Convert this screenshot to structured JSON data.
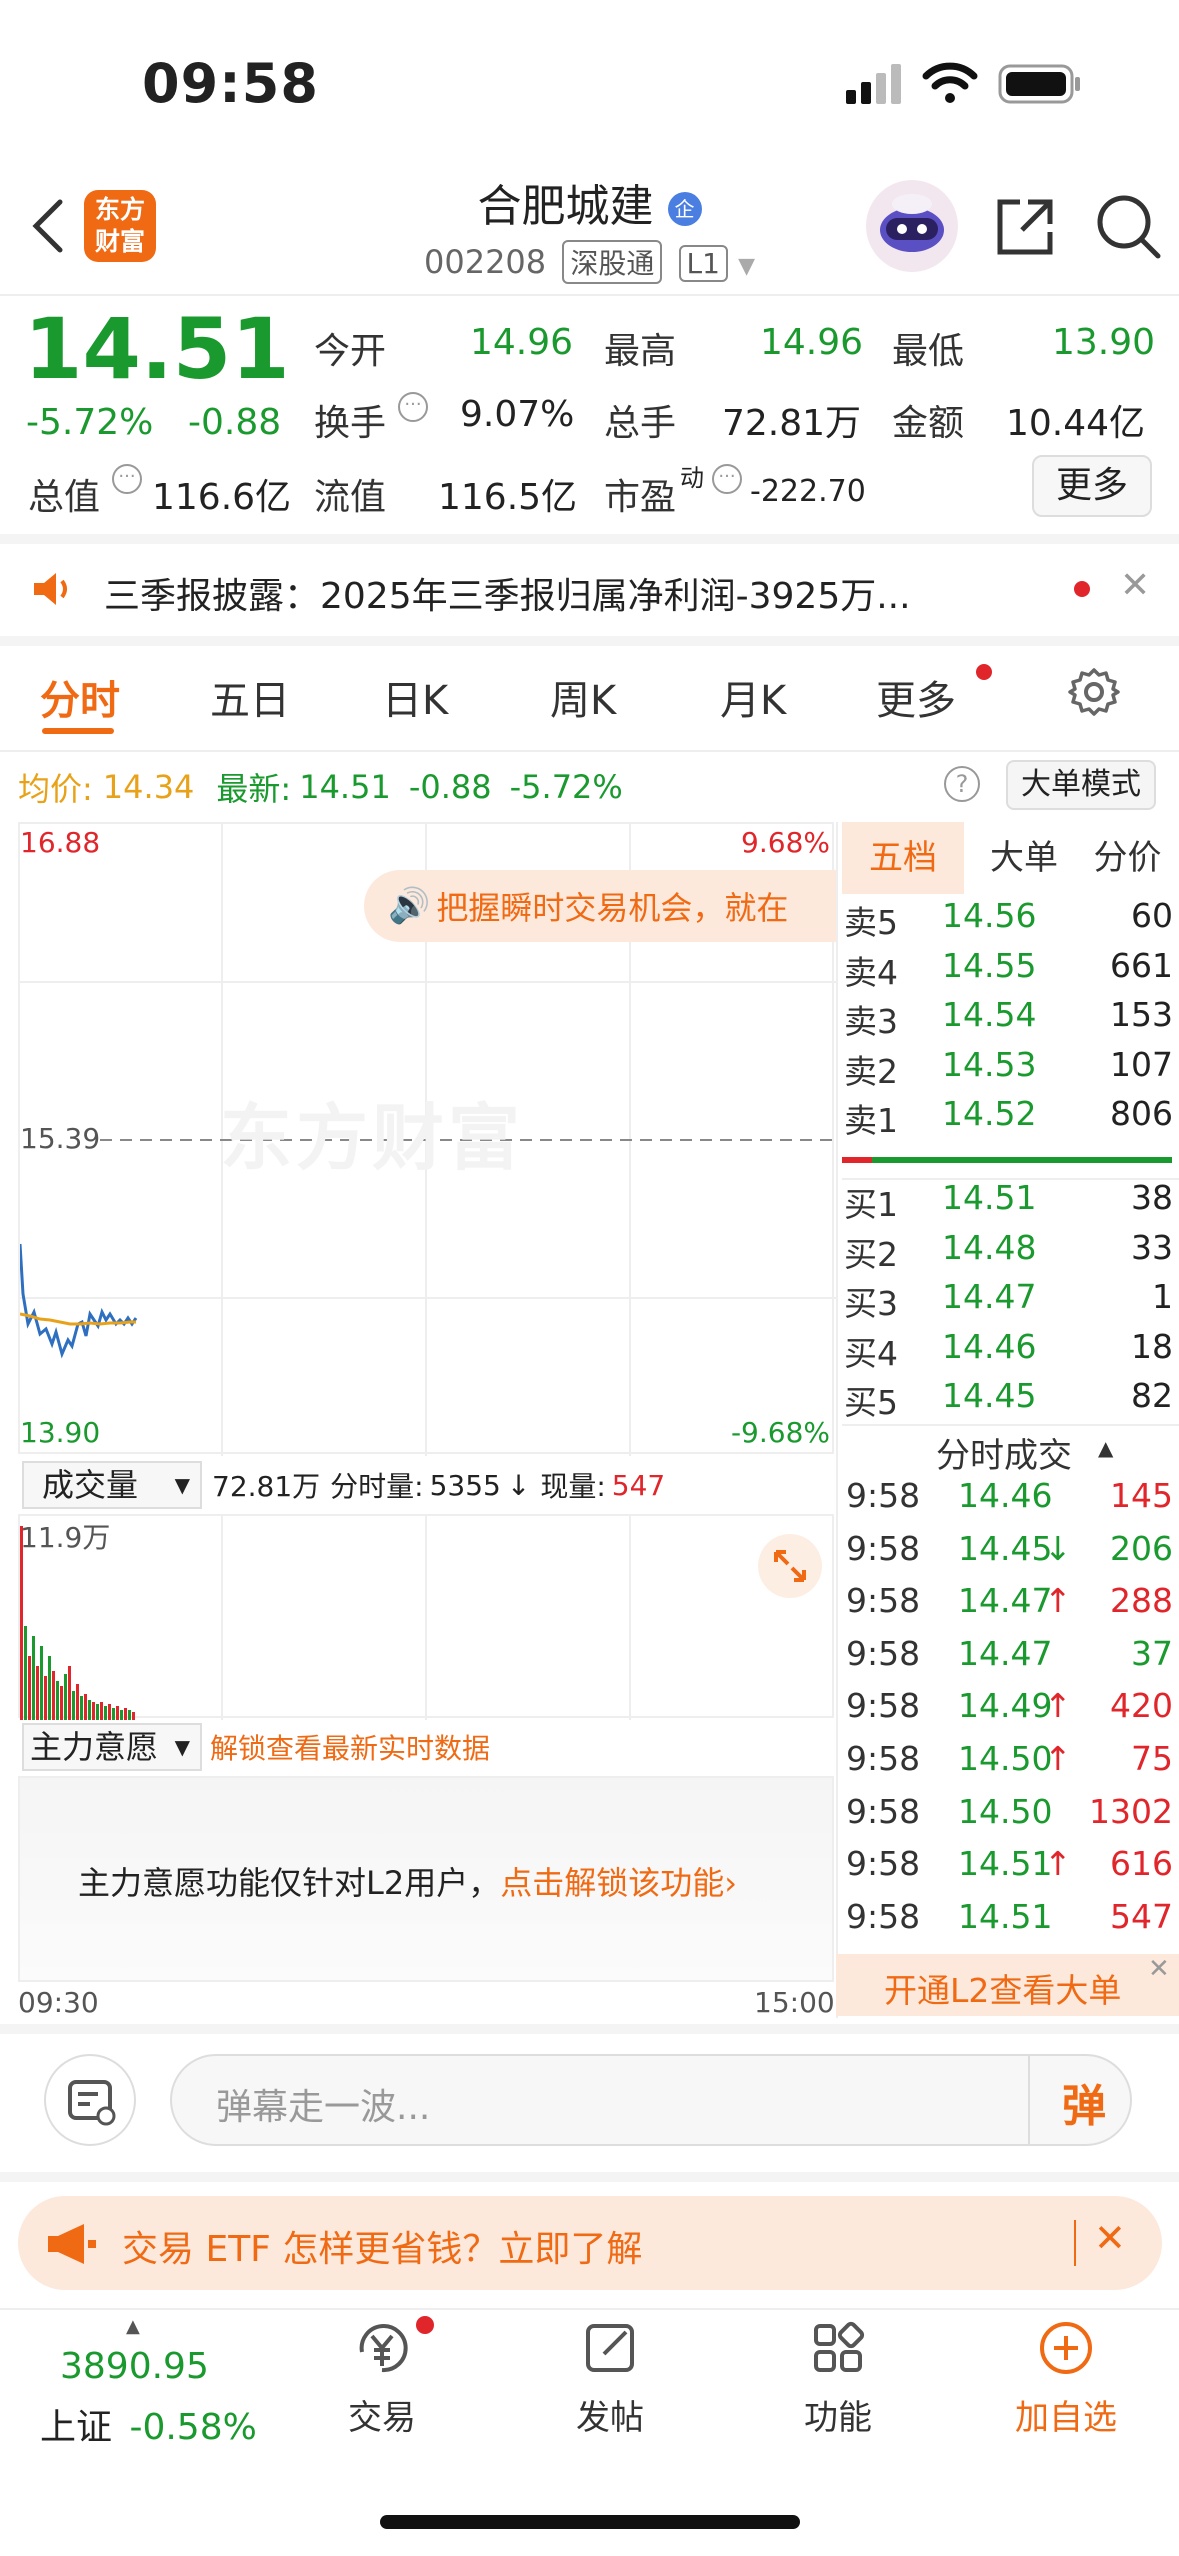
{
  "status_bar": {
    "time": "09:58"
  },
  "header": {
    "title": "合肥城建",
    "title_badge": "企",
    "code": "002208",
    "exchange_tag": "深股通",
    "level_tag": "L1",
    "logo_line1": "东方",
    "logo_line2": "财富"
  },
  "quote": {
    "price": "14.51",
    "change_pct": "-5.72%",
    "change": "-0.88",
    "open_label": "今开",
    "open": "14.96",
    "high_label": "最高",
    "high": "14.96",
    "low_label": "最低",
    "low": "13.90",
    "turnover_label": "换手",
    "turnover": "9.07%",
    "volume_label": "总手",
    "volume": "72.81万",
    "amount_label": "金额",
    "amount": "10.44亿",
    "mktcap_label": "总值",
    "mktcap": "116.6亿",
    "float_label": "流值",
    "float": "116.5亿",
    "pe_label": "市盈",
    "pe_sup": "动",
    "pe": "-222.70",
    "more_label": "更多"
  },
  "news": {
    "text": "三季报披露：2025年三季报归属净利润-3925万..."
  },
  "tabs": [
    {
      "label": "分时",
      "active": true
    },
    {
      "label": "五日"
    },
    {
      "label": "日K"
    },
    {
      "label": "周K"
    },
    {
      "label": "月K"
    },
    {
      "label": "更多"
    }
  ],
  "info_line": {
    "avg_label": "均价:",
    "avg": "14.34",
    "latest_label": "最新:",
    "latest": "14.51",
    "change": "-0.88",
    "change_pct": "-5.72%",
    "mode_label": "大单模式"
  },
  "chart": {
    "top_price": "16.88",
    "top_pct": "9.68%",
    "mid_price": "15.39",
    "bottom_price": "13.90",
    "bottom_pct": "-9.68%",
    "watermark": "东方财富",
    "promo": "把握瞬时交易机会，就在",
    "start_time": "09:30",
    "end_time": "15:00"
  },
  "volume_bar": {
    "select_label": "成交量",
    "total": "72.81万",
    "period_label": "分时量:",
    "period": "5355",
    "current_label": "现量:",
    "current": "547",
    "max_label": "11.9万"
  },
  "main_force": {
    "select_label": "主力意愿",
    "unlock_link": "解锁查看最新实时数据",
    "notice": "主力意愿功能仅针对L2用户，",
    "notice_link": "点击解锁该功能"
  },
  "order_book": {
    "tabs": [
      "五档",
      "大单",
      "分价"
    ],
    "asks": [
      {
        "label": "卖5",
        "price": "14.56",
        "vol": "60"
      },
      {
        "label": "卖4",
        "price": "14.55",
        "vol": "661"
      },
      {
        "label": "卖3",
        "price": "14.54",
        "vol": "153"
      },
      {
        "label": "卖2",
        "price": "14.53",
        "vol": "107"
      },
      {
        "label": "卖1",
        "price": "14.52",
        "vol": "806"
      }
    ],
    "bids": [
      {
        "label": "买1",
        "price": "14.51",
        "vol": "38"
      },
      {
        "label": "买2",
        "price": "14.48",
        "vol": "33"
      },
      {
        "label": "买3",
        "price": "14.47",
        "vol": "1"
      },
      {
        "label": "买4",
        "price": "14.46",
        "vol": "18"
      },
      {
        "label": "买5",
        "price": "14.45",
        "vol": "82"
      }
    ]
  },
  "ticks": {
    "title": "分时成交",
    "rows": [
      {
        "time": "9:58",
        "price": "14.46",
        "arrow": "",
        "vol": "145",
        "color": "red"
      },
      {
        "time": "9:58",
        "price": "14.45",
        "arrow": "↓",
        "vol": "206",
        "color": "green"
      },
      {
        "time": "9:58",
        "price": "14.47",
        "arrow": "↑",
        "vol": "288",
        "color": "red"
      },
      {
        "time": "9:58",
        "price": "14.47",
        "arrow": "",
        "vol": "37",
        "color": "green"
      },
      {
        "time": "9:58",
        "price": "14.49",
        "arrow": "↑",
        "vol": "420",
        "color": "red"
      },
      {
        "time": "9:58",
        "price": "14.50",
        "arrow": "↑",
        "vol": "75",
        "color": "red"
      },
      {
        "time": "9:58",
        "price": "14.50",
        "arrow": "",
        "vol": "1302",
        "color": "red"
      },
      {
        "time": "9:58",
        "price": "14.51",
        "arrow": "↑",
        "vol": "616",
        "color": "red"
      },
      {
        "time": "9:58",
        "price": "14.51",
        "arrow": "",
        "vol": "547",
        "color": "red"
      }
    ],
    "l2_banner": "开通L2查看大单"
  },
  "comment": {
    "placeholder": "弹幕走一波...",
    "send_label": "弹"
  },
  "etf_banner": {
    "text": "交易 ETF 怎样更省钱？立即了解"
  },
  "bottom_nav": {
    "index_value": "3890.95",
    "index_label": "上证",
    "index_change": "-0.58%",
    "trade": "交易",
    "post": "发帖",
    "func": "功能",
    "add_watch": "加自选"
  },
  "colors": {
    "accent": "#f06a14",
    "up": "#e0262b",
    "down": "#1a9a2e"
  }
}
